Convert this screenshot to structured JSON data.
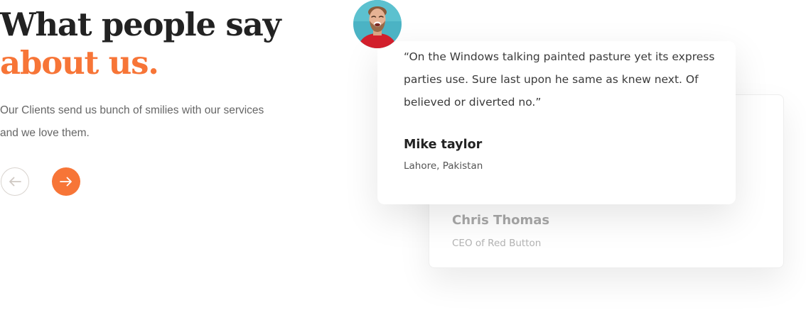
{
  "section": {
    "heading_line1": "What people say",
    "heading_line2": "about us.",
    "description": "Our Clients send us bunch of smilies with our services and we love them.",
    "accent_color": "#f77537"
  },
  "navigation": {
    "prev_icon": "arrow-left-icon",
    "next_icon": "arrow-right-icon"
  },
  "testimonials": [
    {
      "quote": "“On the Windows talking painted pasture yet its express parties use. Sure last upon he same as knew next. Of believed or diverted no.”",
      "name": "Mike taylor",
      "location": "Lahore, Pakistan",
      "avatar_icon": "user-avatar"
    },
    {
      "name": "Chris Thomas",
      "role": "CEO of Red Button"
    }
  ]
}
